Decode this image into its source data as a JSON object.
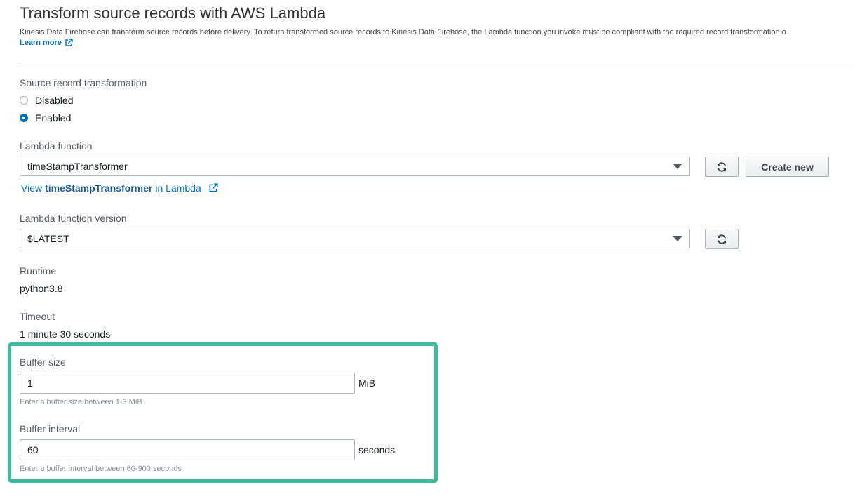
{
  "header": {
    "title": "Transform source records with AWS Lambda",
    "description": "Kinesis Data Firehose can transform source records before delivery. To return transformed source records to Kinesis Data Firehose, the Lambda function you invoke must be compliant with the required record transformation o",
    "learn_more": "Learn more"
  },
  "source_record_transformation": {
    "label": "Source record transformation",
    "options": [
      {
        "label": "Disabled",
        "checked": false
      },
      {
        "label": "Enabled",
        "checked": true
      }
    ]
  },
  "lambda_function": {
    "label": "Lambda function",
    "selected": "timeStampTransformer",
    "create_new_label": "Create new",
    "view_link_prefix": "View",
    "view_link_name": "timeStampTransformer",
    "view_link_suffix": "in Lambda"
  },
  "lambda_version": {
    "label": "Lambda function version",
    "selected": "$LATEST"
  },
  "runtime": {
    "label": "Runtime",
    "value": "python3.8"
  },
  "timeout": {
    "label": "Timeout",
    "value": "1 minute 30 seconds"
  },
  "buffer_size": {
    "label": "Buffer size",
    "value": "1",
    "unit": "MiB",
    "hint": "Enter a buffer size between 1-3 MiB"
  },
  "buffer_interval": {
    "label": "Buffer interval",
    "value": "60",
    "unit": "seconds",
    "hint": "Enter a buffer interval between 60-900 seconds"
  },
  "colors": {
    "link": "#0073bb",
    "highlight": "#3dbda0",
    "radio_selected": "#0073bb"
  },
  "icons": {
    "external": "external-link-icon",
    "refresh": "refresh-icon",
    "caret": "caret-down-icon"
  }
}
